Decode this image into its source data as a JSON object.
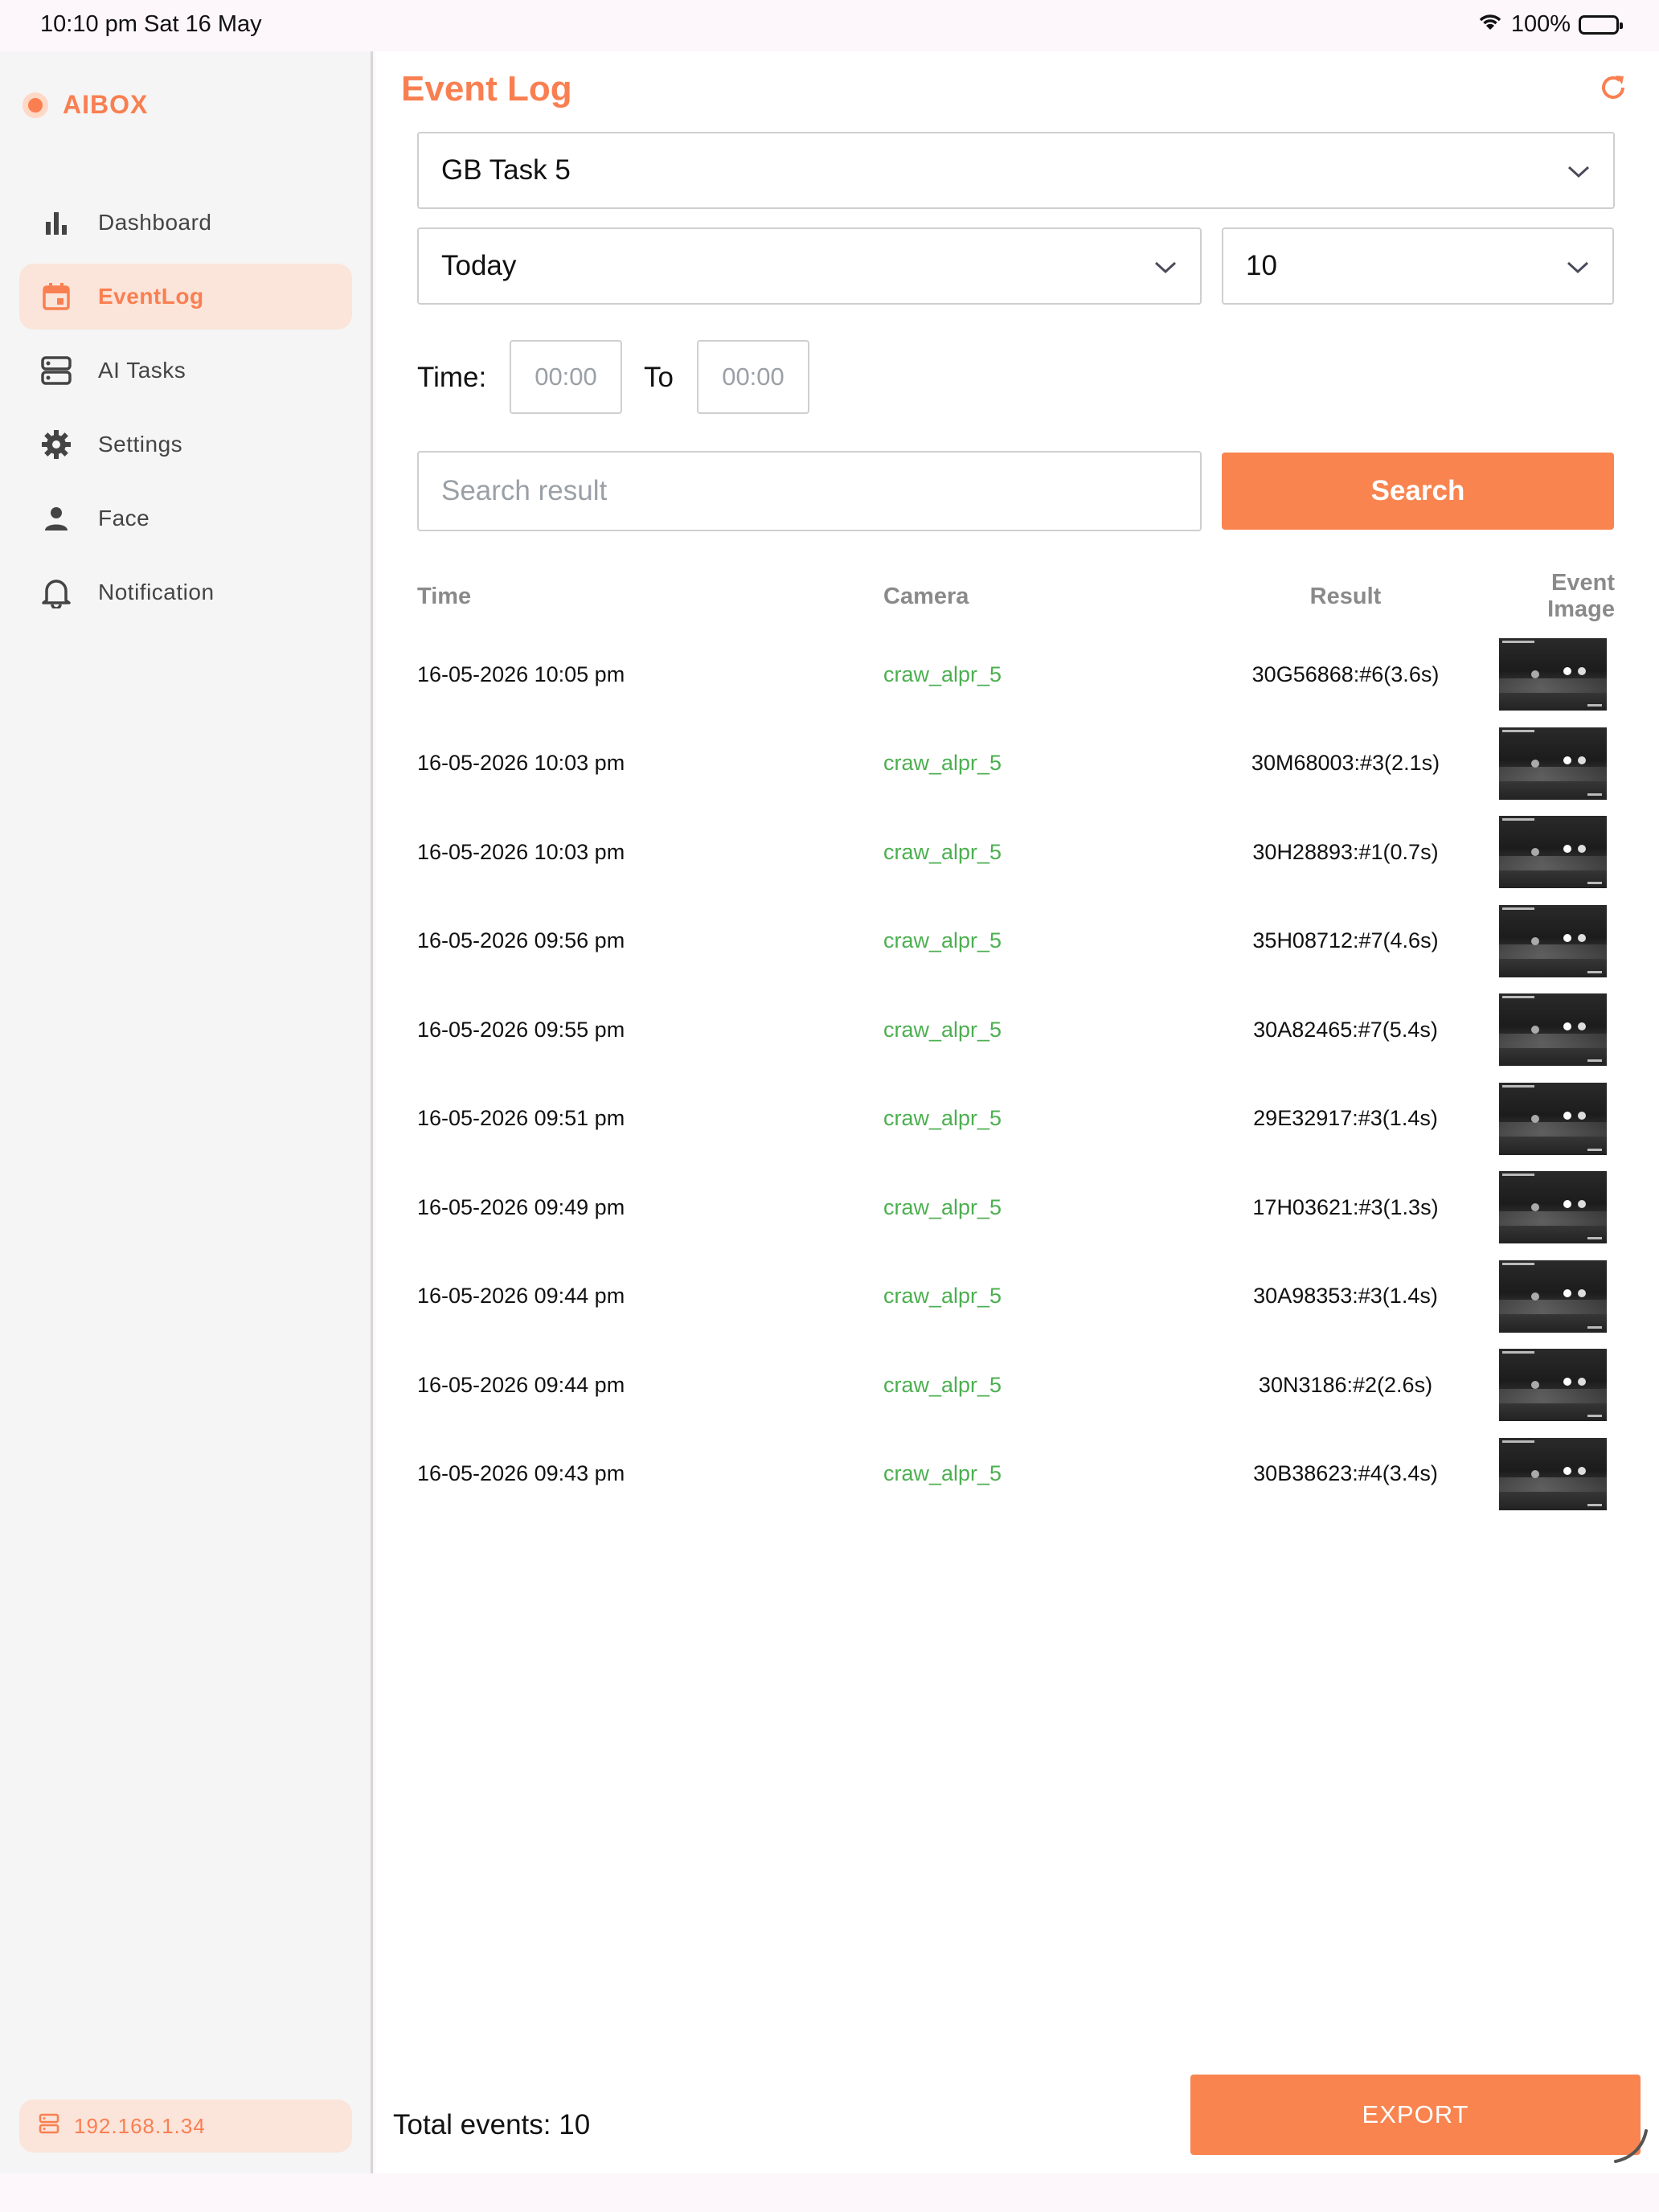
{
  "status_bar": {
    "time": "10:10 pm  Sat 16 May",
    "battery": "100%"
  },
  "sidebar": {
    "brand": "AIBOX",
    "items": [
      {
        "label": "Dashboard",
        "icon": "bar-chart-icon"
      },
      {
        "label": "EventLog",
        "icon": "calendar-icon"
      },
      {
        "label": "AI Tasks",
        "icon": "server-icon"
      },
      {
        "label": "Settings",
        "icon": "gear-icon"
      },
      {
        "label": "Face",
        "icon": "person-icon"
      },
      {
        "label": "Notification",
        "icon": "bell-icon"
      }
    ],
    "active_item": "EventLog",
    "ip": "192.168.1.34"
  },
  "main": {
    "title": "Event Log",
    "task_select": "GB Task 5",
    "date_select": "Today",
    "limit_select": "10",
    "time_label": "Time:",
    "time_from_placeholder": "00:00",
    "to_label": "To",
    "time_to_placeholder": "00:00",
    "search_placeholder": "Search result",
    "search_button": "Search",
    "table": {
      "headers": [
        "Time",
        "Camera",
        "Result",
        "Event Image"
      ],
      "rows": [
        [
          "16-05-2026 10:05 pm",
          "craw_alpr_5",
          "30G56868:#6(3.6s)"
        ],
        [
          "16-05-2026 10:03 pm",
          "craw_alpr_5",
          "30M68003:#3(2.1s)"
        ],
        [
          "16-05-2026 10:03 pm",
          "craw_alpr_5",
          "30H28893:#1(0.7s)"
        ],
        [
          "16-05-2026 09:56 pm",
          "craw_alpr_5",
          "35H08712:#7(4.6s)"
        ],
        [
          "16-05-2026 09:55 pm",
          "craw_alpr_5",
          "30A82465:#7(5.4s)"
        ],
        [
          "16-05-2026 09:51 pm",
          "craw_alpr_5",
          "29E32917:#3(1.4s)"
        ],
        [
          "16-05-2026 09:49 pm",
          "craw_alpr_5",
          "17H03621:#3(1.3s)"
        ],
        [
          "16-05-2026 09:44 pm",
          "craw_alpr_5",
          "30A98353:#3(1.4s)"
        ],
        [
          "16-05-2026 09:44 pm",
          "craw_alpr_5",
          "30N3186:#2(2.6s)"
        ],
        [
          "16-05-2026 09:43 pm",
          "craw_alpr_5",
          "30B38623:#4(3.4s)"
        ]
      ]
    },
    "total_events": "Total events: 10",
    "export_button": "EXPORT"
  },
  "colors": {
    "accent": "#f97f51",
    "camera_text": "#4caf50",
    "active_bg": "#fbe4d9"
  }
}
